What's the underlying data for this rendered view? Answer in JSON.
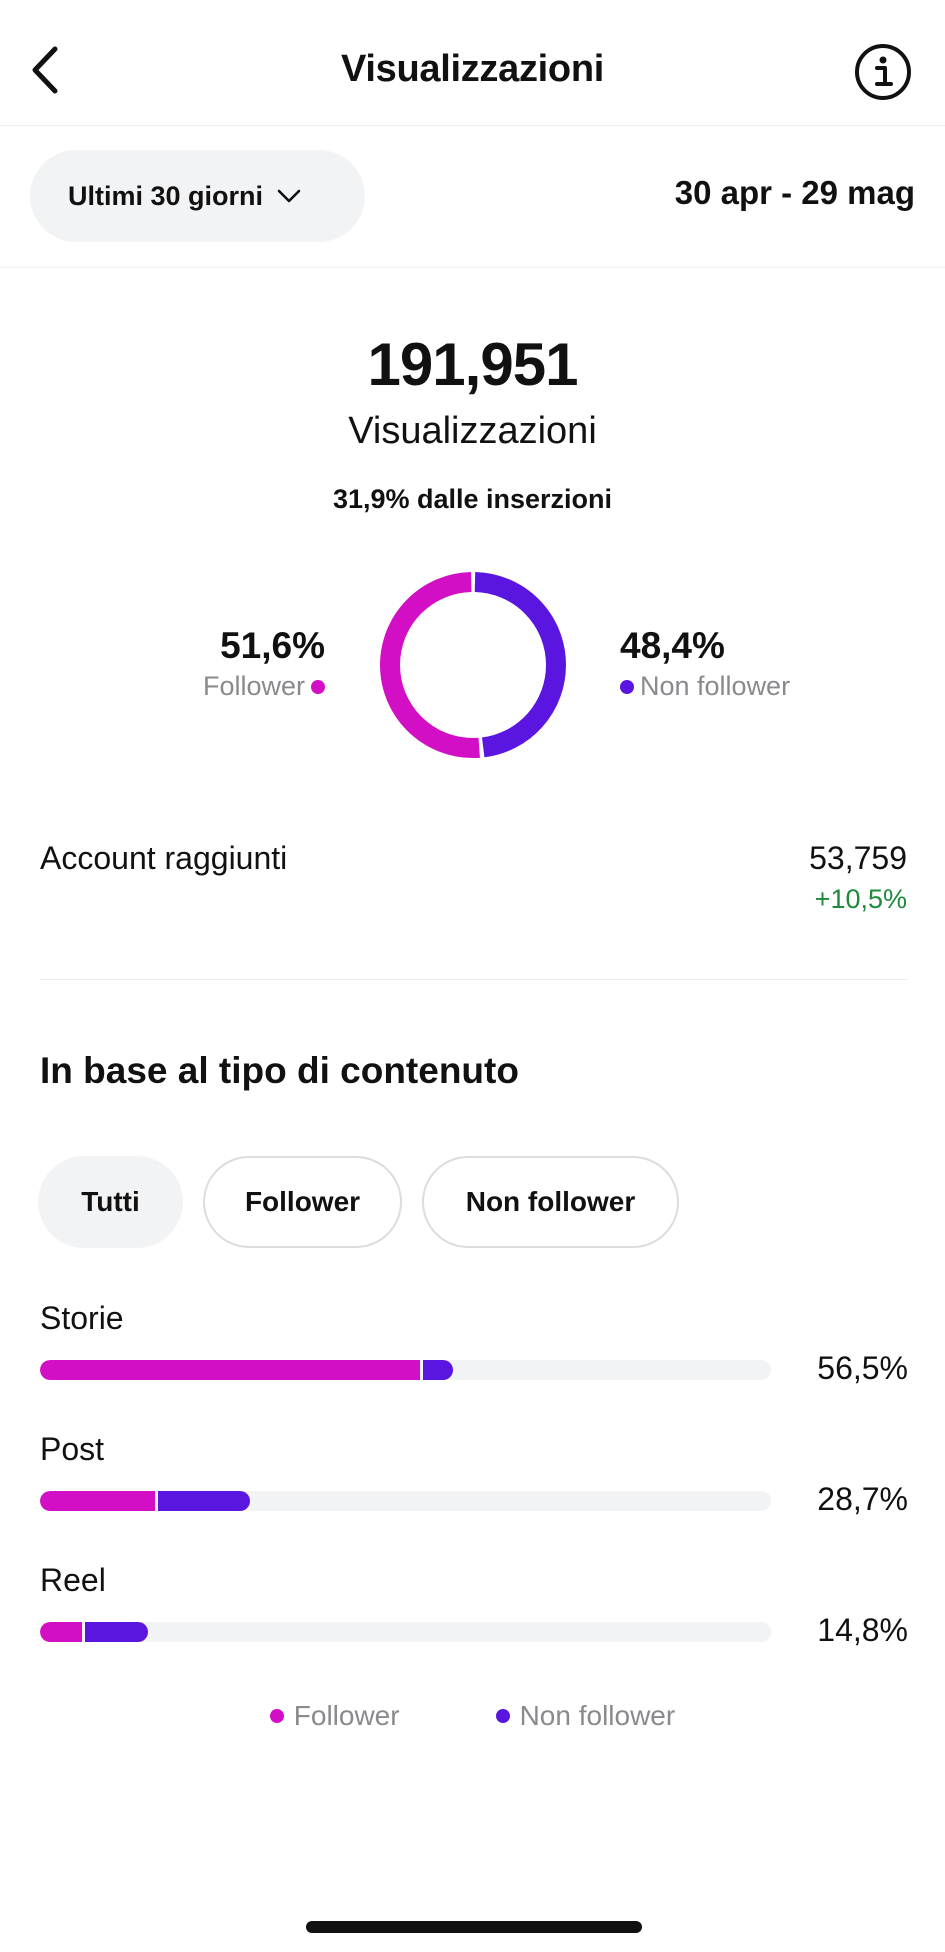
{
  "header": {
    "title": "Visualizzazioni",
    "back_icon": "chevron-left-icon",
    "info_icon": "info-circle-icon"
  },
  "range": {
    "selector_label": "Ultimi 30 giorni",
    "dates": "30 apr - 29 mag"
  },
  "summary": {
    "total": "191,951",
    "label": "Visualizzazioni",
    "ads_note": "31,9% dalle inserzioni",
    "follower_pct": "51,6%",
    "follower_label": "Follower",
    "nonfollower_pct": "48,4%",
    "nonfollower_label": "Non follower"
  },
  "donut": {
    "follower_share": 0.516,
    "nonfollower_share": 0.484
  },
  "reach": {
    "label": "Account raggiunti",
    "value": "53,759",
    "delta": "+10,5%"
  },
  "content_type": {
    "title": "In base al tipo di contenuto",
    "filters": [
      "Tutti",
      "Follower",
      "Non follower"
    ],
    "active_filter": "Tutti",
    "rows": [
      {
        "name": "Storie",
        "pct": "56,5%",
        "total": 0.565,
        "follower": 0.52,
        "nonfollower": 0.045
      },
      {
        "name": "Post",
        "pct": "28,7%",
        "total": 0.287,
        "follower": 0.158,
        "nonfollower": 0.129
      },
      {
        "name": "Reel",
        "pct": "14,8%",
        "total": 0.148,
        "follower": 0.058,
        "nonfollower": 0.09
      }
    ],
    "legend": {
      "follower": "Follower",
      "nonfollower": "Non follower"
    }
  },
  "colors": {
    "follower": "#d20fc4",
    "nonfollower": "#5a16e0",
    "positive": "#1d8a3c"
  }
}
